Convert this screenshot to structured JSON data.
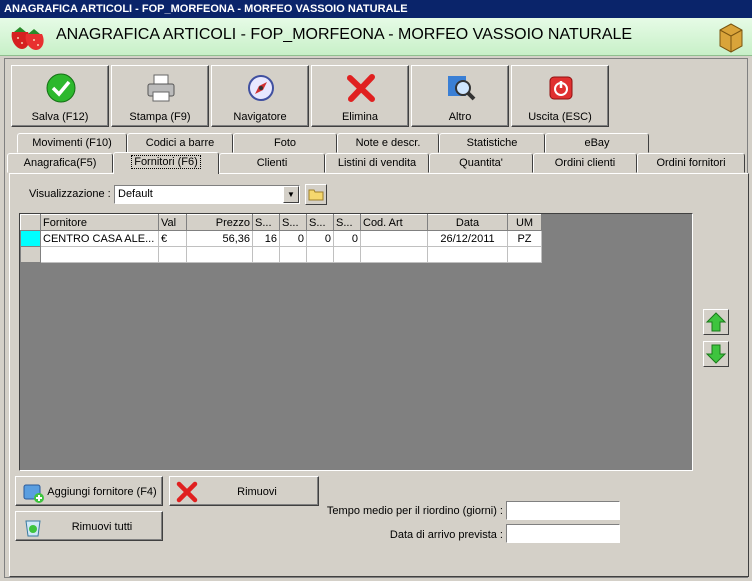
{
  "window": {
    "title": "ANAGRAFICA ARTICOLI - FOP_MORFEONA - MORFEO VASSOIO NATURALE"
  },
  "header": {
    "title": "ANAGRAFICA ARTICOLI - FOP_MORFEONA - MORFEO VASSOIO NATURALE"
  },
  "toolbar": {
    "save": "Salva (F12)",
    "print": "Stampa (F9)",
    "navigator": "Navigatore",
    "delete": "Elimina",
    "other": "Altro",
    "exit": "Uscita (ESC)"
  },
  "tabs_row1": [
    "Movimenti (F10)",
    "Codici a barre",
    "Foto",
    "Note e descr.",
    "Statistiche",
    "eBay"
  ],
  "tabs_row2": [
    "Anagrafica(F5)",
    "Fornitori (F6)",
    "Clienti",
    "Listini di vendita",
    "Quantita'",
    "Ordini clienti",
    "Ordini fornitori"
  ],
  "visualization": {
    "label": "Visualizzazione :",
    "value": "Default"
  },
  "grid": {
    "columns": [
      "Fornitore",
      "Val",
      "Prezzo",
      "S...",
      "S...",
      "S...",
      "S...",
      "Cod. Art",
      "Data",
      "UM"
    ],
    "rows": [
      [
        "CENTRO CASA ALE...",
        "€",
        "56,36",
        "16",
        "0",
        "0",
        "0",
        "",
        "26/12/2011",
        "PZ"
      ]
    ]
  },
  "actions": {
    "add_supplier": "Aggiungi fornitore (F4)",
    "remove": "Rimuovi",
    "remove_all": "Rimuovi tutti"
  },
  "form": {
    "avg_time_label": "Tempo medio per il riordino (giorni) :",
    "avg_time_value": "",
    "arrival_label": "Data di arrivo prevista :",
    "arrival_value": ""
  },
  "colors": {
    "title_bg": "#0a246a",
    "header_bg": "#c8f0c8",
    "face": "#d4d0c8",
    "selection": "#00ffff"
  }
}
